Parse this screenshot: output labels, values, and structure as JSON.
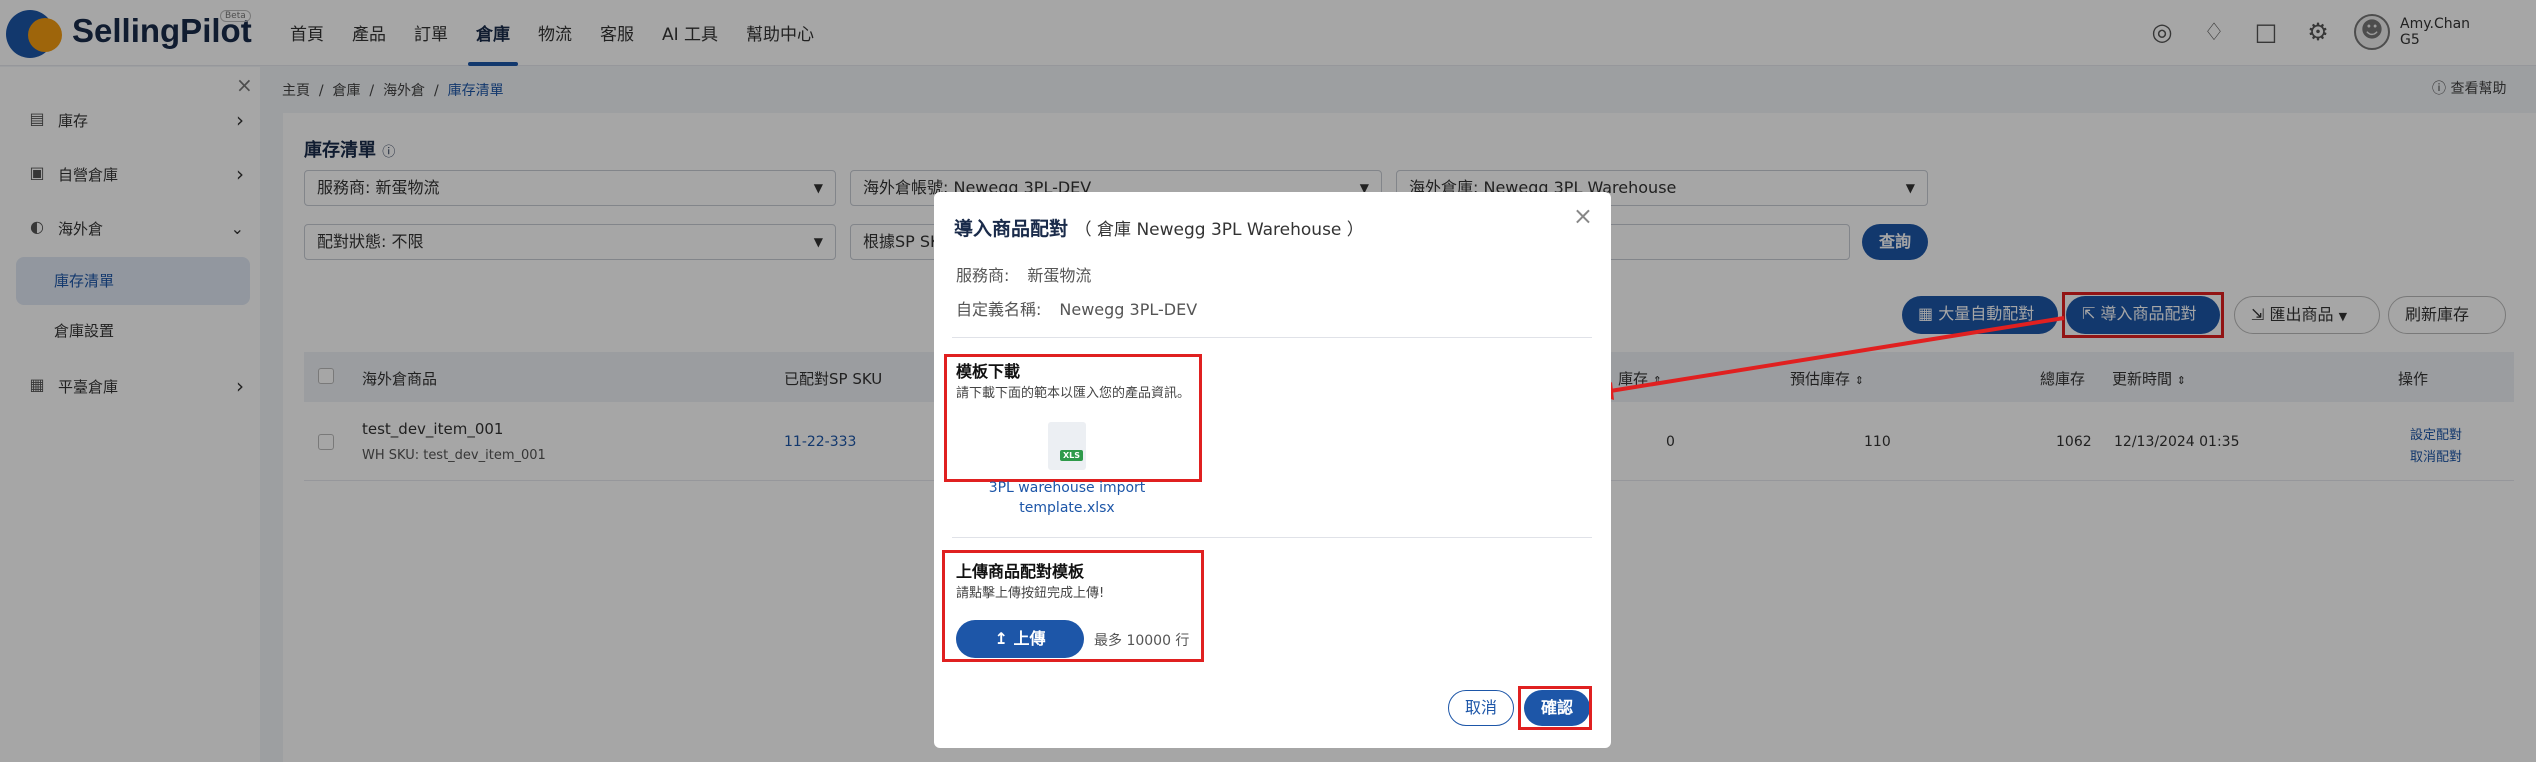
{
  "header": {
    "brand": "SellingPilot",
    "beta": "Beta",
    "nav": [
      "首頁",
      "產品",
      "訂單",
      "倉庫",
      "物流",
      "客服",
      "AI 工具",
      "幫助中心"
    ],
    "active_nav": "倉庫",
    "user_name": "Amy.Chan",
    "user_sub": "G5",
    "icons": [
      "globe-icon",
      "bell-icon",
      "feedback-icon",
      "gear-icon",
      "user-icon"
    ]
  },
  "sidebar": {
    "items": [
      {
        "label": "庫存",
        "icon": "inventory-icon"
      },
      {
        "label": "自營倉庫",
        "icon": "warehouse-icon"
      },
      {
        "label": "海外倉",
        "icon": "overseas-icon"
      },
      {
        "label": "平臺倉庫",
        "icon": "platform-icon"
      }
    ],
    "subitems": [
      "庫存清單",
      "倉庫設置"
    ]
  },
  "breadcrumb": [
    "主頁",
    "倉庫",
    "海外倉",
    "庫存清單"
  ],
  "help_label": "查看幫助",
  "page": {
    "title": "庫存清單",
    "filters": {
      "provider": "服務商: 新蛋物流",
      "account": "海外倉帳號: Newegg 3PL-DEV",
      "warehouse": "海外倉庫: Newegg 3PL Warehouse",
      "status": "配對狀態: 不限",
      "search_by": "根據SP SKU"
    },
    "query_label": "查詢",
    "actions": {
      "auto_match": "大量自動配對",
      "import_match": "導入商品配對",
      "export": "匯出商品",
      "refresh": "刷新庫存"
    },
    "table": {
      "headers": {
        "product": "海外倉商品",
        "sp_sku": "已配對SP SKU",
        "stock": "庫存",
        "forecast": "預估庫存",
        "total": "總庫存",
        "updated": "更新時間",
        "ops": "操作"
      },
      "rows": [
        {
          "name": "test_dev_item_001",
          "wh_sku": "WH SKU: test_dev_item_001",
          "sp_sku": "11-22-333",
          "stock": "0",
          "forecast": "110",
          "total": "1062",
          "updated": "12/13/2024 01:35",
          "op1": "設定配對",
          "op2": "取消配對"
        }
      ]
    }
  },
  "modal": {
    "title": "導入商品配對",
    "subtitle": "（ 倉庫 Newegg 3PL Warehouse ）",
    "provider_label": "服務商:",
    "provider_value": "新蛋物流",
    "alias_label": "自定義名稱:",
    "alias_value": "Newegg 3PL-DEV",
    "template_title": "模板下載",
    "template_desc": "請下載下面的範本以匯入您的產品資訊。",
    "file_tag": "XLS",
    "file_name": "3PL warehouse import template.xlsx",
    "upload_title": "上傳商品配對模板",
    "upload_desc": "請點擊上傳按鈕完成上傳!",
    "upload_label": "上傳",
    "upload_hint": "最多 10000 行",
    "cancel_label": "取消",
    "confirm_label": "確認"
  }
}
